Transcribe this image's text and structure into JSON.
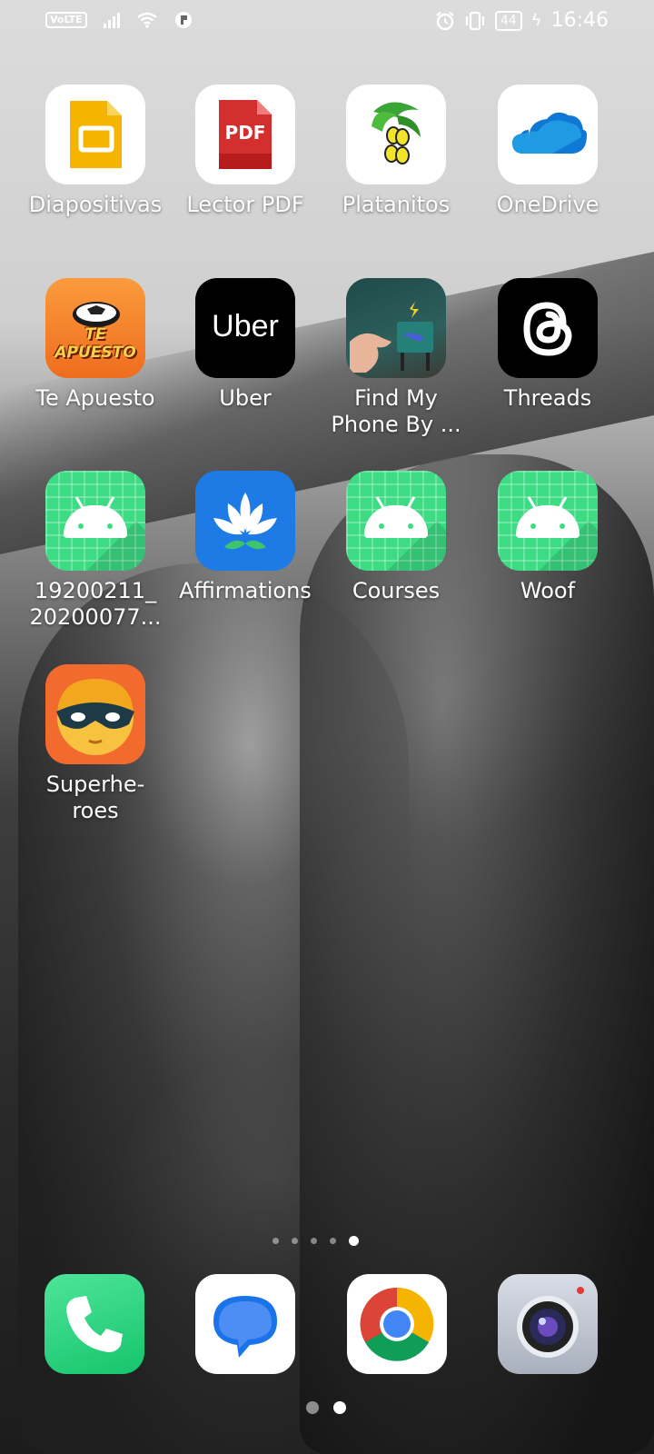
{
  "status_bar": {
    "volte": "VoLTE",
    "battery": "44",
    "time": "16:46"
  },
  "apps": [
    {
      "label": "Diapositivas",
      "icon": "slides-icon"
    },
    {
      "label": "Lector PDF",
      "icon": "pdf-reader-icon",
      "icon_text": "PDF"
    },
    {
      "label": "Platanitos",
      "icon": "platanitos-icon"
    },
    {
      "label": "OneDrive",
      "icon": "onedrive-cloud-icon"
    },
    {
      "label": "Te Apuesto",
      "icon": "te-apuesto-icon",
      "icon_text": "TE APUESTO"
    },
    {
      "label": "Uber",
      "icon": "uber-icon",
      "icon_text": "Uber"
    },
    {
      "label": "Find My\nPhone By ...",
      "icon": "find-my-phone-icon"
    },
    {
      "label": "Threads",
      "icon": "threads-icon"
    },
    {
      "label": "19200211_\n20200077...",
      "icon": "android-icon"
    },
    {
      "label": "Affirmations",
      "icon": "lotus-icon"
    },
    {
      "label": "Courses",
      "icon": "android-icon"
    },
    {
      "label": "Woof",
      "icon": "android-icon"
    },
    {
      "label": "Superhe-\nroes",
      "icon": "superhero-mask-icon"
    }
  ],
  "dock": [
    {
      "icon": "phone-icon"
    },
    {
      "icon": "messages-icon"
    },
    {
      "icon": "chrome-icon"
    },
    {
      "icon": "camera-icon"
    }
  ],
  "page_indicator": {
    "count": 5,
    "active": 5
  },
  "bottom_indicator": {
    "count": 2,
    "active": 2
  },
  "colors": {
    "slides_yellow": "#f4b400",
    "pdf_red": "#d32f2f",
    "onedrive_blue": "#0f78d4",
    "te_apuesto_orange": "#f7842b",
    "android_green": "#3ddc84",
    "affirmations_blue": "#1e7be6",
    "superhero_orange": "#f26a2e",
    "phone_green": "#2ed47a",
    "messages_blue": "#1a73e8"
  }
}
